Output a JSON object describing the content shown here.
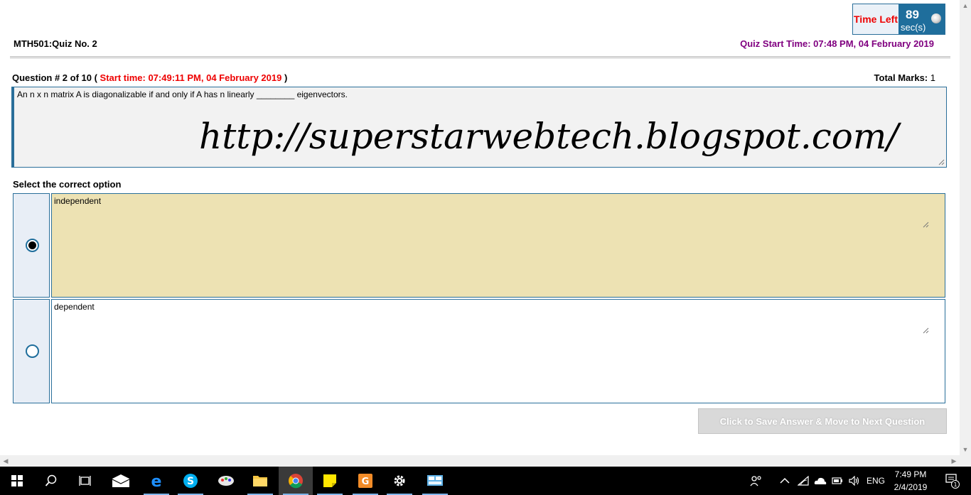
{
  "timer": {
    "label": "Time Left",
    "value": "89",
    "unit": "sec(s)"
  },
  "quiz": {
    "title": "MTH501:Quiz No. 2",
    "start_time": "Quiz Start Time: 07:48 PM, 04 February 2019"
  },
  "question": {
    "header_prefix": "Question # 2 of 10 (",
    "start_time": "Start time: 07:49:11 PM, 04 February 2019",
    "header_suffix": ")",
    "total_marks_label": "Total Marks:",
    "total_marks_value": "1",
    "text": "An n x n matrix A is diagonalizable if and only if A has n linearly ________ eigenvectors.",
    "watermark": "http://superstarwebtech.blogspot.com/"
  },
  "select_label": "Select the correct option",
  "options": [
    {
      "text": "independent",
      "selected": true,
      "background": "#ede2b3"
    },
    {
      "text": "dependent",
      "selected": false,
      "background": "#ffffff"
    }
  ],
  "save_button": "Click to Save Answer & Move to Next Question",
  "taskbar": {
    "icons": [
      "windows-start-icon",
      "search-icon",
      "task-view-icon",
      "mail-icon",
      "edge-icon",
      "skype-icon",
      "paint-icon",
      "file-explorer-icon",
      "chrome-icon",
      "sticky-notes-icon",
      "pdf-icon",
      "settings-icon",
      "control-panel-icon"
    ],
    "language": "ENG",
    "time": "7:49 PM",
    "date": "2/4/2019",
    "notification_count": "1"
  }
}
